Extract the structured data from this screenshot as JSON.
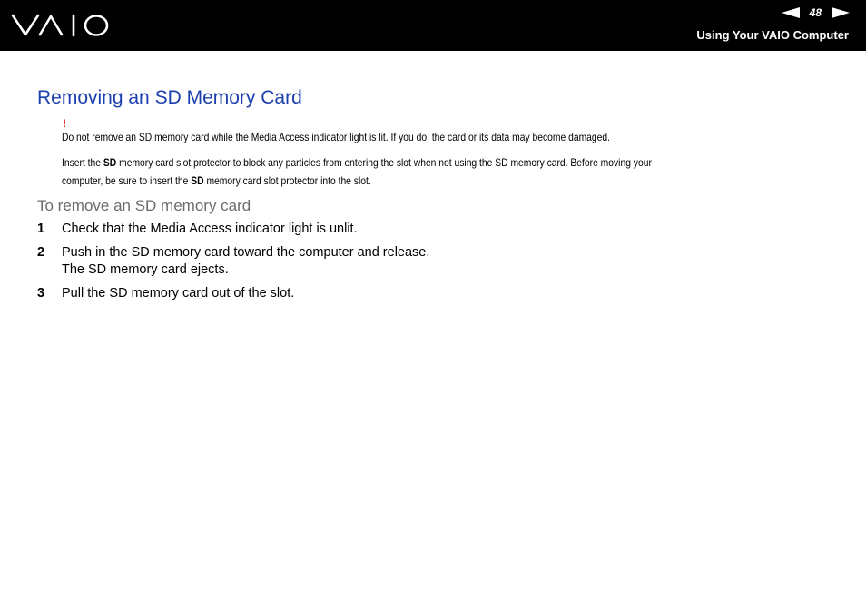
{
  "header": {
    "brand": "VAIO",
    "page_number": "48",
    "section": "Using Your VAIO Computer",
    "icons": {
      "prev": "left-triangle-icon",
      "next": "right-triangle-icon"
    }
  },
  "page": {
    "title": "Removing an SD Memory Card",
    "warning_mark": "!",
    "warning_text": "Do not remove an SD memory card while the Media Access indicator light is lit. If you do, the card or its data may become damaged.",
    "note": {
      "t1": "Insert the ",
      "b1": "SD",
      "t2": " memory card slot protector to block any particles from entering the slot when not using the SD memory card. Before moving your",
      "t3": "computer, be sure to insert the ",
      "b2": "SD",
      "t4": " memory card slot protector into the slot."
    },
    "procedure_title": "To remove an SD memory card",
    "steps": [
      {
        "num": "1",
        "text": "Check that the Media Access indicator light is unlit.",
        "subtext": ""
      },
      {
        "num": "2",
        "text": "Push in the SD memory card toward the computer and release.",
        "subtext": "The SD memory card ejects."
      },
      {
        "num": "3",
        "text": "Pull the SD memory card out of the slot.",
        "subtext": ""
      }
    ]
  },
  "colors": {
    "header_bg": "#000000",
    "title": "#1c3fae",
    "subtitle": "#6b6b6b",
    "warning": "#d40000"
  }
}
